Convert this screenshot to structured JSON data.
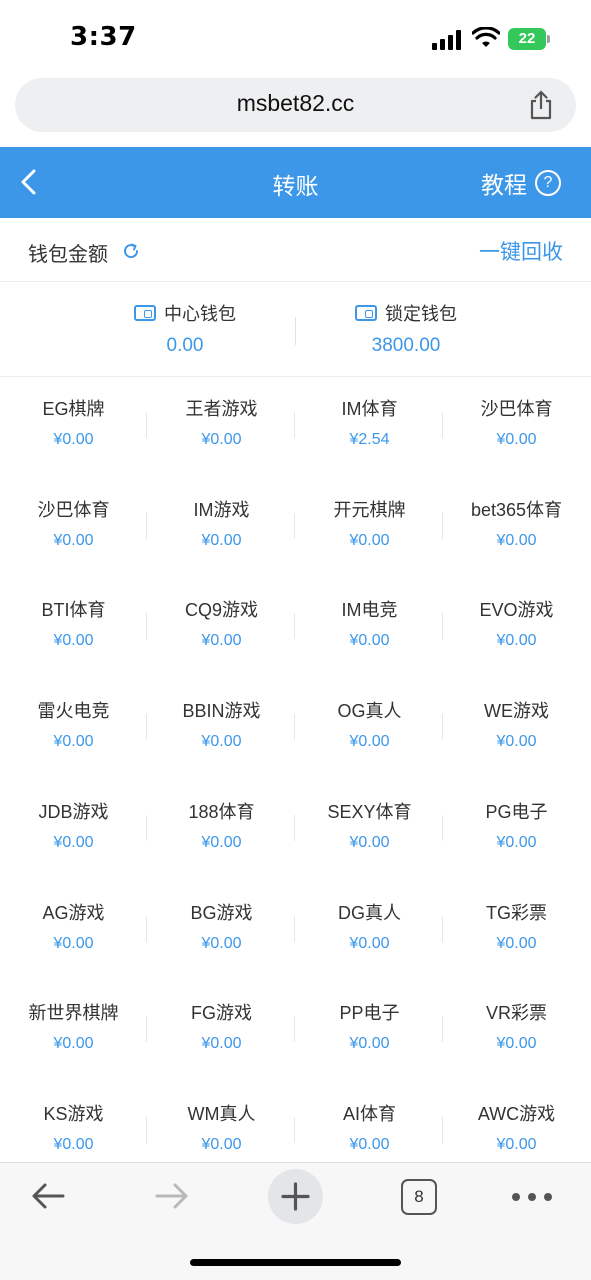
{
  "status_bar": {
    "time": "3:37",
    "battery": "22"
  },
  "browser": {
    "url": "msbet82.cc",
    "tab_count": "8"
  },
  "header": {
    "title": "转账",
    "tutorial_label": "教程",
    "help_glyph": "?"
  },
  "wallet_bar": {
    "label": "钱包金额",
    "recover_all_label": "一键回收"
  },
  "main_wallets": [
    {
      "name": "中心钱包",
      "amount": "0.00"
    },
    {
      "name": "锁定钱包",
      "amount": "3800.00"
    }
  ],
  "games": [
    {
      "name": "EG棋牌",
      "amount": "¥0.00"
    },
    {
      "name": "王者游戏",
      "amount": "¥0.00"
    },
    {
      "name": "IM体育",
      "amount": "¥2.54"
    },
    {
      "name": "沙巴体育",
      "amount": "¥0.00"
    },
    {
      "name": "沙巴体育",
      "amount": "¥0.00"
    },
    {
      "name": "IM游戏",
      "amount": "¥0.00"
    },
    {
      "name": "开元棋牌",
      "amount": "¥0.00"
    },
    {
      "name": "bet365体育",
      "amount": "¥0.00"
    },
    {
      "name": "BTI体育",
      "amount": "¥0.00"
    },
    {
      "name": "CQ9游戏",
      "amount": "¥0.00"
    },
    {
      "name": "IM电竞",
      "amount": "¥0.00"
    },
    {
      "name": "EVO游戏",
      "amount": "¥0.00"
    },
    {
      "name": "雷火电竞",
      "amount": "¥0.00"
    },
    {
      "name": "BBIN游戏",
      "amount": "¥0.00"
    },
    {
      "name": "OG真人",
      "amount": "¥0.00"
    },
    {
      "name": "WE游戏",
      "amount": "¥0.00"
    },
    {
      "name": "JDB游戏",
      "amount": "¥0.00"
    },
    {
      "name": "188体育",
      "amount": "¥0.00"
    },
    {
      "name": "SEXY体育",
      "amount": "¥0.00"
    },
    {
      "name": "PG电子",
      "amount": "¥0.00"
    },
    {
      "name": "AG游戏",
      "amount": "¥0.00"
    },
    {
      "name": "BG游戏",
      "amount": "¥0.00"
    },
    {
      "name": "DG真人",
      "amount": "¥0.00"
    },
    {
      "name": "TG彩票",
      "amount": "¥0.00"
    },
    {
      "name": "新世界棋牌",
      "amount": "¥0.00"
    },
    {
      "name": "FG游戏",
      "amount": "¥0.00"
    },
    {
      "name": "PP电子",
      "amount": "¥0.00"
    },
    {
      "name": "VR彩票",
      "amount": "¥0.00"
    },
    {
      "name": "KS游戏",
      "amount": "¥0.00"
    },
    {
      "name": "WM真人",
      "amount": "¥0.00"
    },
    {
      "name": "AI体育",
      "amount": "¥0.00"
    },
    {
      "name": "AWC游戏",
      "amount": "¥0.00"
    }
  ],
  "colors": {
    "accent": "#3d97e9",
    "battery": "#34c759"
  }
}
